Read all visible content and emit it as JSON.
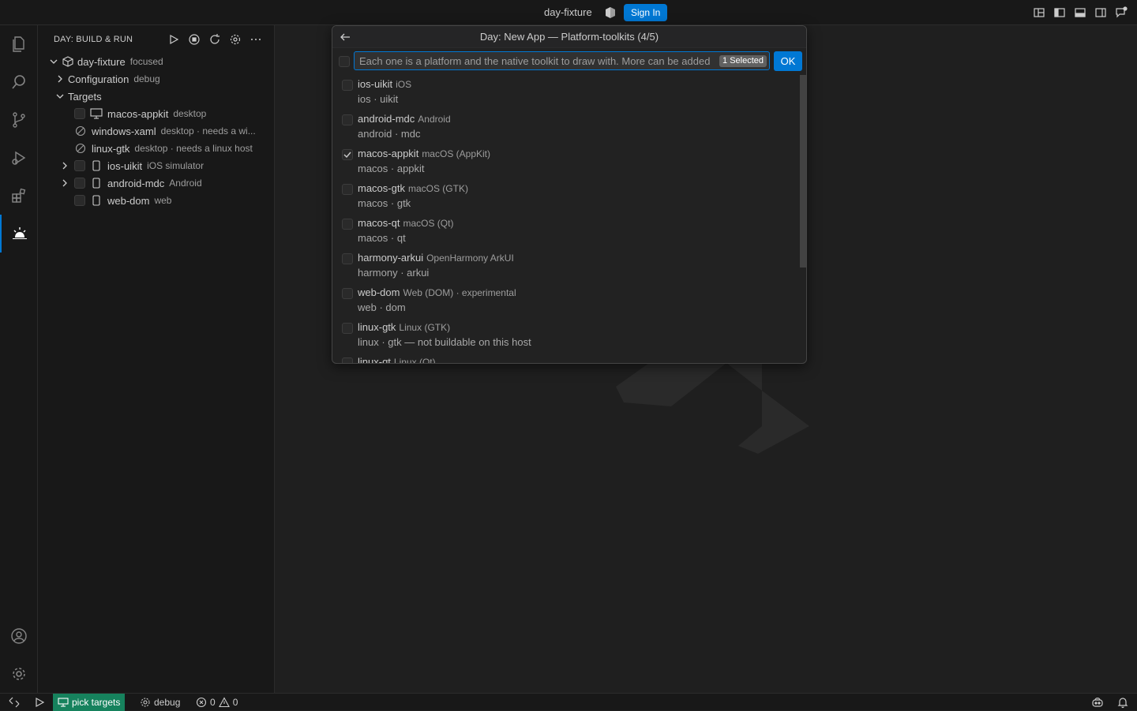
{
  "titlebar": {
    "title": "day-fixture",
    "signin_label": "Sign In"
  },
  "sidebar": {
    "header": "DAY: BUILD & RUN",
    "tree": [
      {
        "label": "day-fixture",
        "desc": "focused"
      },
      {
        "label": "Configuration",
        "desc": "debug"
      },
      {
        "label": "Targets",
        "desc": ""
      },
      {
        "label": "macos-appkit",
        "desc": "desktop"
      },
      {
        "label": "windows-xaml",
        "desc": "desktop · needs a wi..."
      },
      {
        "label": "linux-gtk",
        "desc": "desktop · needs a linux host"
      },
      {
        "label": "ios-uikit",
        "desc": "iOS simulator"
      },
      {
        "label": "android-mdc",
        "desc": "Android"
      },
      {
        "label": "web-dom",
        "desc": "web"
      }
    ]
  },
  "quickpick": {
    "title": "Day: New App — Platform-toolkits (4/5)",
    "placeholder": "Each one is a platform and the native toolkit to draw with. More can be added",
    "selected_count": "1 Selected",
    "ok_label": "OK",
    "items": [
      {
        "label": "ios-uikit",
        "desc": "iOS",
        "detail": "ios · uikit",
        "checked": false
      },
      {
        "label": "android-mdc",
        "desc": "Android",
        "detail": "android · mdc",
        "checked": false
      },
      {
        "label": "macos-appkit",
        "desc": "macOS (AppKit)",
        "detail": "macos · appkit",
        "checked": true
      },
      {
        "label": "macos-gtk",
        "desc": "macOS (GTK)",
        "detail": "macos · gtk",
        "checked": false
      },
      {
        "label": "macos-qt",
        "desc": "macOS (Qt)",
        "detail": "macos · qt",
        "checked": false
      },
      {
        "label": "harmony-arkui",
        "desc": "OpenHarmony ArkUI",
        "detail": "harmony · arkui",
        "checked": false
      },
      {
        "label": "web-dom",
        "desc": "Web (DOM) · experimental",
        "detail": "web · dom",
        "checked": false
      },
      {
        "label": "linux-gtk",
        "desc": "Linux (GTK)",
        "detail": "linux · gtk — not buildable on this host",
        "checked": false
      },
      {
        "label": "linux-qt",
        "desc": "Linux (Qt)",
        "detail": "",
        "checked": false
      }
    ]
  },
  "statusbar": {
    "pick_targets": "pick targets",
    "debug": "debug",
    "errors": "0",
    "warnings": "0"
  },
  "colors": {
    "accent": "#0078d4",
    "status_highlight": "#16825d"
  }
}
